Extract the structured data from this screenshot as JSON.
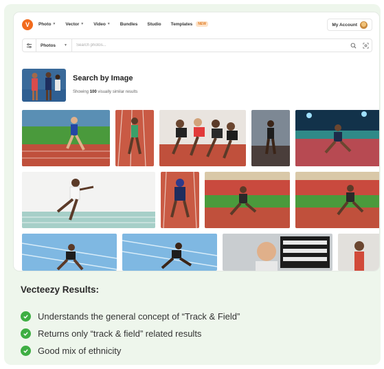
{
  "brand": {
    "logo_glyph": "V",
    "color": "#f26b1d"
  },
  "nav": {
    "items": [
      {
        "label": "Photo",
        "dropdown": true
      },
      {
        "label": "Vector",
        "dropdown": true
      },
      {
        "label": "Video",
        "dropdown": true
      },
      {
        "label": "Bundles",
        "dropdown": false
      },
      {
        "label": "Studio",
        "dropdown": false
      },
      {
        "label": "Templates",
        "dropdown": false,
        "badge": "NEW"
      }
    ],
    "account_label": "My Account"
  },
  "search": {
    "type_label": "Photos",
    "placeholder": "Search photos..."
  },
  "search_by_image": {
    "title": "Search by Image",
    "subtitle_prefix": "Showing",
    "count": "100",
    "subtitle_suffix": "visually similar results"
  },
  "results": {
    "title": "Vecteezy Results:",
    "bullets": [
      "Understands the general concept of “Track & Field”",
      "Returns only “track & field” related results",
      "Good mix of ethnicity"
    ]
  },
  "colors": {
    "accent_green": "#3eae43",
    "panel_bg": "#eef6ec",
    "track_red": "#c0503c",
    "grass_green": "#4a9a3c"
  }
}
